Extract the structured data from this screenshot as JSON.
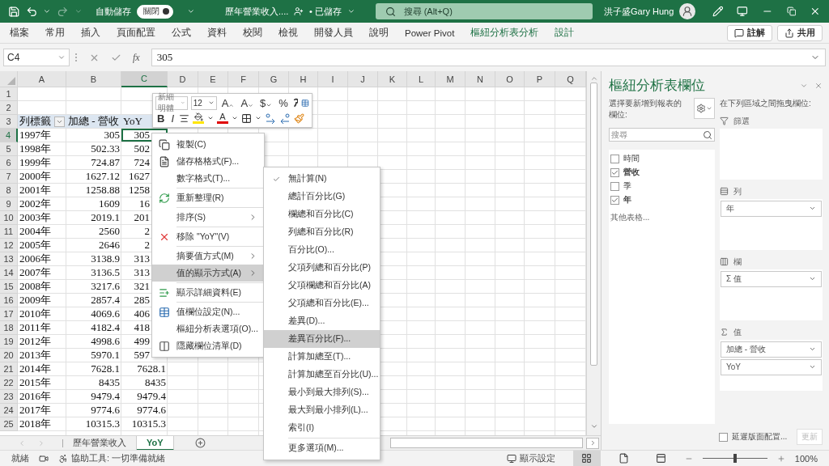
{
  "title_bar": {
    "autosave_label": "自動儲存",
    "autosave_toggle": {
      "label": "關閉",
      "on": false
    },
    "document": "歷年營業收入....",
    "save_status": "• 已儲存",
    "search": {
      "placeholder": "搜尋 (Alt+Q)"
    },
    "user": "洪子盛Gary Hung"
  },
  "ribbon": {
    "tabs": [
      {
        "label": "檔案",
        "contextual": false
      },
      {
        "label": "常用",
        "contextual": false
      },
      {
        "label": "插入",
        "contextual": false
      },
      {
        "label": "頁面配置",
        "contextual": false
      },
      {
        "label": "公式",
        "contextual": false
      },
      {
        "label": "資料",
        "contextual": false
      },
      {
        "label": "校閱",
        "contextual": false
      },
      {
        "label": "檢視",
        "contextual": false
      },
      {
        "label": "開發人員",
        "contextual": false
      },
      {
        "label": "說明",
        "contextual": false
      },
      {
        "label": "Power Pivot",
        "contextual": false
      },
      {
        "label": "樞紐分析表分析",
        "contextual": true
      },
      {
        "label": "設計",
        "contextual": true
      }
    ],
    "comment_button": "註解",
    "share_button": "共用"
  },
  "formula_bar": {
    "name_box": "C4",
    "fx": "fx",
    "value": "305"
  },
  "sheet": {
    "columns": [
      {
        "label": "A",
        "selected": false
      },
      {
        "label": "B",
        "selected": false
      },
      {
        "label": "C",
        "selected": true
      },
      {
        "label": "D",
        "selected": false
      },
      {
        "label": "E",
        "selected": false
      },
      {
        "label": "F",
        "selected": false
      },
      {
        "label": "G",
        "selected": false
      },
      {
        "label": "H",
        "selected": false
      },
      {
        "label": "I",
        "selected": false
      },
      {
        "label": "J",
        "selected": false
      },
      {
        "label": "K",
        "selected": false
      },
      {
        "label": "L",
        "selected": false
      },
      {
        "label": "M",
        "selected": false
      },
      {
        "label": "N",
        "selected": false
      },
      {
        "label": "O",
        "selected": false
      },
      {
        "label": "P",
        "selected": false
      },
      {
        "label": "Q",
        "selected": false
      }
    ],
    "rows": [
      {
        "label": "1",
        "selected": false,
        "kind": "empty"
      },
      {
        "label": "2",
        "selected": false,
        "kind": "empty"
      },
      {
        "label": "3",
        "selected": false,
        "kind": "header",
        "year": "列標籤",
        "revenue": "加總 - 營收",
        "yoy": {
          "text": "YoY",
          "active": false
        }
      },
      {
        "label": "4",
        "selected": true,
        "kind": "data",
        "year": "1997年",
        "revenue": "305",
        "yoy": {
          "text": "305",
          "covered": true,
          "active": true
        }
      },
      {
        "label": "5",
        "selected": false,
        "kind": "data",
        "year": "1998年",
        "revenue": "502.33",
        "yoy": {
          "text": "502",
          "covered": true,
          "active": false
        }
      },
      {
        "label": "6",
        "selected": false,
        "kind": "data",
        "year": "1999年",
        "revenue": "724.87",
        "yoy": {
          "text": "724",
          "covered": true,
          "active": false
        }
      },
      {
        "label": "7",
        "selected": false,
        "kind": "data",
        "year": "2000年",
        "revenue": "1627.12",
        "yoy": {
          "text": "1627",
          "covered": true,
          "active": false
        }
      },
      {
        "label": "8",
        "selected": false,
        "kind": "data",
        "year": "2001年",
        "revenue": "1258.88",
        "yoy": {
          "text": "1258",
          "covered": true,
          "active": false
        }
      },
      {
        "label": "9",
        "selected": false,
        "kind": "data",
        "year": "2002年",
        "revenue": "1609",
        "yoy": {
          "text": "16",
          "covered": true,
          "active": false
        }
      },
      {
        "label": "10",
        "selected": false,
        "kind": "data",
        "year": "2003年",
        "revenue": "2019.1",
        "yoy": {
          "text": "201",
          "covered": true,
          "active": false
        }
      },
      {
        "label": "11",
        "selected": false,
        "kind": "data",
        "year": "2004年",
        "revenue": "2560",
        "yoy": {
          "text": "2",
          "covered": true,
          "active": false
        }
      },
      {
        "label": "12",
        "selected": false,
        "kind": "data",
        "year": "2005年",
        "revenue": "2646",
        "yoy": {
          "text": "2",
          "covered": true,
          "active": false
        }
      },
      {
        "label": "13",
        "selected": false,
        "kind": "data",
        "year": "2006年",
        "revenue": "3138.9",
        "yoy": {
          "text": "313",
          "covered": true,
          "active": false
        }
      },
      {
        "label": "14",
        "selected": false,
        "kind": "data",
        "year": "2007年",
        "revenue": "3136.5",
        "yoy": {
          "text": "313",
          "covered": true,
          "active": false
        }
      },
      {
        "label": "15",
        "selected": false,
        "kind": "data",
        "year": "2008年",
        "revenue": "3217.6",
        "yoy": {
          "text": "321",
          "covered": true,
          "active": false
        }
      },
      {
        "label": "16",
        "selected": false,
        "kind": "data",
        "year": "2009年",
        "revenue": "2857.4",
        "yoy": {
          "text": "285",
          "covered": true,
          "active": false
        }
      },
      {
        "label": "17",
        "selected": false,
        "kind": "data",
        "year": "2010年",
        "revenue": "4069.6",
        "yoy": {
          "text": "406",
          "covered": true,
          "active": false
        }
      },
      {
        "label": "18",
        "selected": false,
        "kind": "data",
        "year": "2011年",
        "revenue": "4182.4",
        "yoy": {
          "text": "418",
          "covered": true,
          "active": false
        }
      },
      {
        "label": "19",
        "selected": false,
        "kind": "data",
        "year": "2012年",
        "revenue": "4998.6",
        "yoy": {
          "text": "499",
          "covered": true,
          "active": false
        }
      },
      {
        "label": "20",
        "selected": false,
        "kind": "data",
        "year": "2013年",
        "revenue": "5970.1",
        "yoy": {
          "text": "597",
          "covered": true,
          "active": false
        }
      },
      {
        "label": "21",
        "selected": false,
        "kind": "data",
        "year": "2014年",
        "revenue": "7628.1",
        "yoy": {
          "text": "7628.1",
          "covered": false,
          "active": false
        }
      },
      {
        "label": "22",
        "selected": false,
        "kind": "data",
        "year": "2015年",
        "revenue": "8435",
        "yoy": {
          "text": "8435",
          "covered": false,
          "active": false
        }
      },
      {
        "label": "23",
        "selected": false,
        "kind": "data",
        "year": "2016年",
        "revenue": "9479.4",
        "yoy": {
          "text": "9479.4",
          "covered": false,
          "active": false
        }
      },
      {
        "label": "24",
        "selected": false,
        "kind": "data",
        "year": "2017年",
        "revenue": "9774.6",
        "yoy": {
          "text": "9774.6",
          "covered": false,
          "active": false
        }
      },
      {
        "label": "25",
        "selected": false,
        "kind": "data",
        "year": "2018年",
        "revenue": "10315.3",
        "yoy": {
          "text": "10315.3",
          "covered": false,
          "active": false
        }
      }
    ]
  },
  "mini_toolbar": {
    "font": "新細明體",
    "size": "12",
    "grow_font": "A",
    "shrink_font": "A",
    "currency": "$",
    "percent": "%",
    "bold": "B",
    "italic": "I",
    "font_color": "A"
  },
  "context_menu": {
    "items": [
      {
        "label": "複製(C)",
        "kind": "copy",
        "submenu": false,
        "selected": false,
        "divider_before": false
      },
      {
        "label": "儲存格格式(F)...",
        "kind": "format",
        "submenu": false,
        "selected": false,
        "divider_before": false
      },
      {
        "label": "數字格式(T)...",
        "kind": "plain",
        "submenu": false,
        "selected": false,
        "divider_before": false
      },
      {
        "label": "重新整理(R)",
        "kind": "refresh",
        "submenu": false,
        "selected": false,
        "divider_before": true
      },
      {
        "label": "排序(S)",
        "kind": "plain",
        "submenu": true,
        "selected": false,
        "divider_before": true
      },
      {
        "label": "移除 \"YoY\"(V)",
        "kind": "remove",
        "submenu": false,
        "selected": false,
        "divider_before": true
      },
      {
        "label": "摘要值方式(M)",
        "kind": "plain",
        "submenu": true,
        "selected": false,
        "divider_before": true
      },
      {
        "label": "值的顯示方式(A)",
        "kind": "plain",
        "submenu": true,
        "selected": true,
        "divider_before": false
      },
      {
        "label": "顯示詳細資料(E)",
        "kind": "details",
        "submenu": false,
        "selected": false,
        "divider_before": true
      },
      {
        "label": "值欄位設定(N)...",
        "kind": "field-settings",
        "submenu": false,
        "selected": false,
        "divider_before": true
      },
      {
        "label": "樞紐分析表選項(O)...",
        "kind": "plain",
        "submenu": false,
        "selected": false,
        "divider_before": false
      },
      {
        "label": "隱藏欄位清單(D)",
        "kind": "field-list",
        "submenu": false,
        "selected": false,
        "divider_before": false
      }
    ]
  },
  "show_values_as_menu": {
    "items": [
      {
        "label": "無計算(N)",
        "checked": true,
        "selected": false,
        "divider_before": false
      },
      {
        "label": "總計百分比(G)",
        "checked": false,
        "selected": false,
        "divider_before": false
      },
      {
        "label": "欄總和百分比(C)",
        "checked": false,
        "selected": false,
        "divider_before": false
      },
      {
        "label": "列總和百分比(R)",
        "checked": false,
        "selected": false,
        "divider_before": false
      },
      {
        "label": "百分比(O)...",
        "checked": false,
        "selected": false,
        "divider_before": false
      },
      {
        "label": "父項列總和百分比(P)",
        "checked": false,
        "selected": false,
        "divider_before": false
      },
      {
        "label": "父項欄總和百分比(A)",
        "checked": false,
        "selected": false,
        "divider_before": false
      },
      {
        "label": "父項總和百分比(E)...",
        "checked": false,
        "selected": false,
        "divider_before": false
      },
      {
        "label": "差異(D)...",
        "checked": false,
        "selected": false,
        "divider_before": false
      },
      {
        "label": "差異百分比(F)...",
        "checked": false,
        "selected": true,
        "divider_before": false
      },
      {
        "label": "計算加總至(T)...",
        "checked": false,
        "selected": false,
        "divider_before": false
      },
      {
        "label": "計算加總至百分比(U)...",
        "checked": false,
        "selected": false,
        "divider_before": false
      },
      {
        "label": "最小到最大排列(S)...",
        "checked": false,
        "selected": false,
        "divider_before": false
      },
      {
        "label": "最大到最小排列(L)...",
        "checked": false,
        "selected": false,
        "divider_before": false
      },
      {
        "label": "索引(I)",
        "checked": false,
        "selected": false,
        "divider_before": false
      },
      {
        "label": "更多選項(M)...",
        "checked": false,
        "selected": false,
        "divider_before": true
      }
    ]
  },
  "sheet_tabs": [
    {
      "label": "歷年營業收入",
      "selected": false
    },
    {
      "label": "YoY",
      "selected": true
    }
  ],
  "status_bar": {
    "status": "就緒",
    "accessibility": "協助工具: 一切準備就緒",
    "display_settings": "顯示設定",
    "views": [
      {
        "kind": "normal",
        "selected": true
      },
      {
        "kind": "page-layout",
        "selected": false
      },
      {
        "kind": "page-break",
        "selected": false
      }
    ],
    "zoom": {
      "level": 0.5,
      "reading": "100%"
    }
  },
  "pivot_panel": {
    "title": "樞紐分析表欄位",
    "choose_label": "選擇要新增到報表的欄位:",
    "search": {
      "placeholder": "搜尋"
    },
    "fields": [
      {
        "label": "時間",
        "checked": false
      },
      {
        "label": "營收",
        "checked": true
      },
      {
        "label": "季",
        "checked": false
      },
      {
        "label": "年",
        "checked": true
      }
    ],
    "more_tables": "其他表格...",
    "drag_label": "在下列區域之間拖曳欄位:",
    "areas": [
      {
        "kind": "filter",
        "label": "篩選"
      },
      {
        "kind": "rows",
        "label": "列",
        "items": [
          "年"
        ]
      },
      {
        "kind": "columns",
        "label": "欄",
        "items": [
          "Σ 值"
        ]
      },
      {
        "kind": "values",
        "label": "值",
        "items": [
          "加總 - 營收",
          "YoY"
        ]
      }
    ],
    "defer": {
      "label": "延遲版面配置...",
      "checked": false
    },
    "update_button": {
      "label": "更新",
      "disabled": true
    }
  }
}
